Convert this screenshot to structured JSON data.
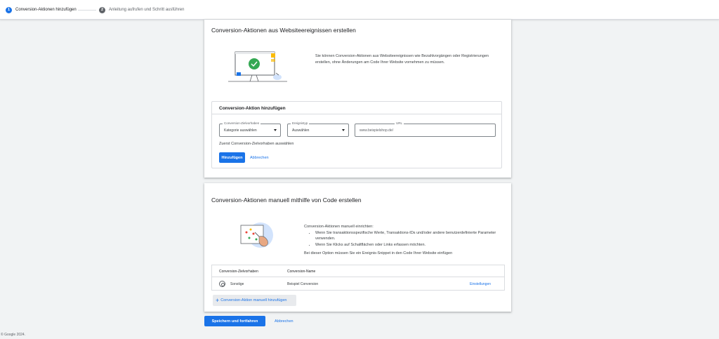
{
  "stepper": {
    "step1": {
      "num": "1",
      "label": "Conversion-Aktionen hinzufügen"
    },
    "step2": {
      "num": "2",
      "label": "Anleitung aufrufen und Schritt ausführen"
    }
  },
  "section_web": {
    "title": "Conversion-Aktionen aus Websiteereignissen erstellen",
    "description": "Sie können Conversion-Aktionen aus Websiteereignissen wie Bezahlvorgängen oder Registrierungen erstellen, ohne Änderungen am Code Ihrer Website vornehmen zu müssen.",
    "box_title": "Conversion-Aktion hinzufügen",
    "goal_field": {
      "label": "Conversion-Zielvorhaben",
      "value": "Kategorie auswählen"
    },
    "type_field": {
      "label": "Ereignistyp",
      "value": "Auswählen"
    },
    "url_field": {
      "label": "URL",
      "placeholder": "www.beispielshop.de/"
    },
    "hint": "Zuerst Conversion-Zielvorhaben auswählen",
    "add_button": "Hinzufügen",
    "cancel_link": "Abbrechen"
  },
  "section_manual": {
    "title": "Conversion-Aktionen manuell mithilfe von Code erstellen",
    "intro": "Conversion-Aktionen manuell einrichten:",
    "bullets": [
      "Wenn Sie transaktionsspezifische Werte, Transaktions-IDs und/oder andere benutzerdefinierte Parameter verwenden.",
      "Wenn Sie Klicks auf Schaltflächen oder Links erfassen möchten."
    ],
    "note": "Bei dieser Option müssen Sie ein Ereignis-Snippet in den Code Ihrer Website einfügen",
    "table": {
      "headers": [
        "Conversion-Zielvorhaben",
        "Conversion-Name"
      ],
      "rows": [
        {
          "category": "Sonstige",
          "name": "Beispiel Conversion",
          "action": "Einstellungen"
        }
      ]
    },
    "add_manual_button": "Conversion-Aktion manuell hinzufügen"
  },
  "actions": {
    "save": "Speichern und fortfahren",
    "cancel": "Abbrechen"
  },
  "footer": "© Google 2024.",
  "colors": {
    "primary": "#1a73e8",
    "background": "#f1f3f4",
    "success": "#34a853"
  }
}
